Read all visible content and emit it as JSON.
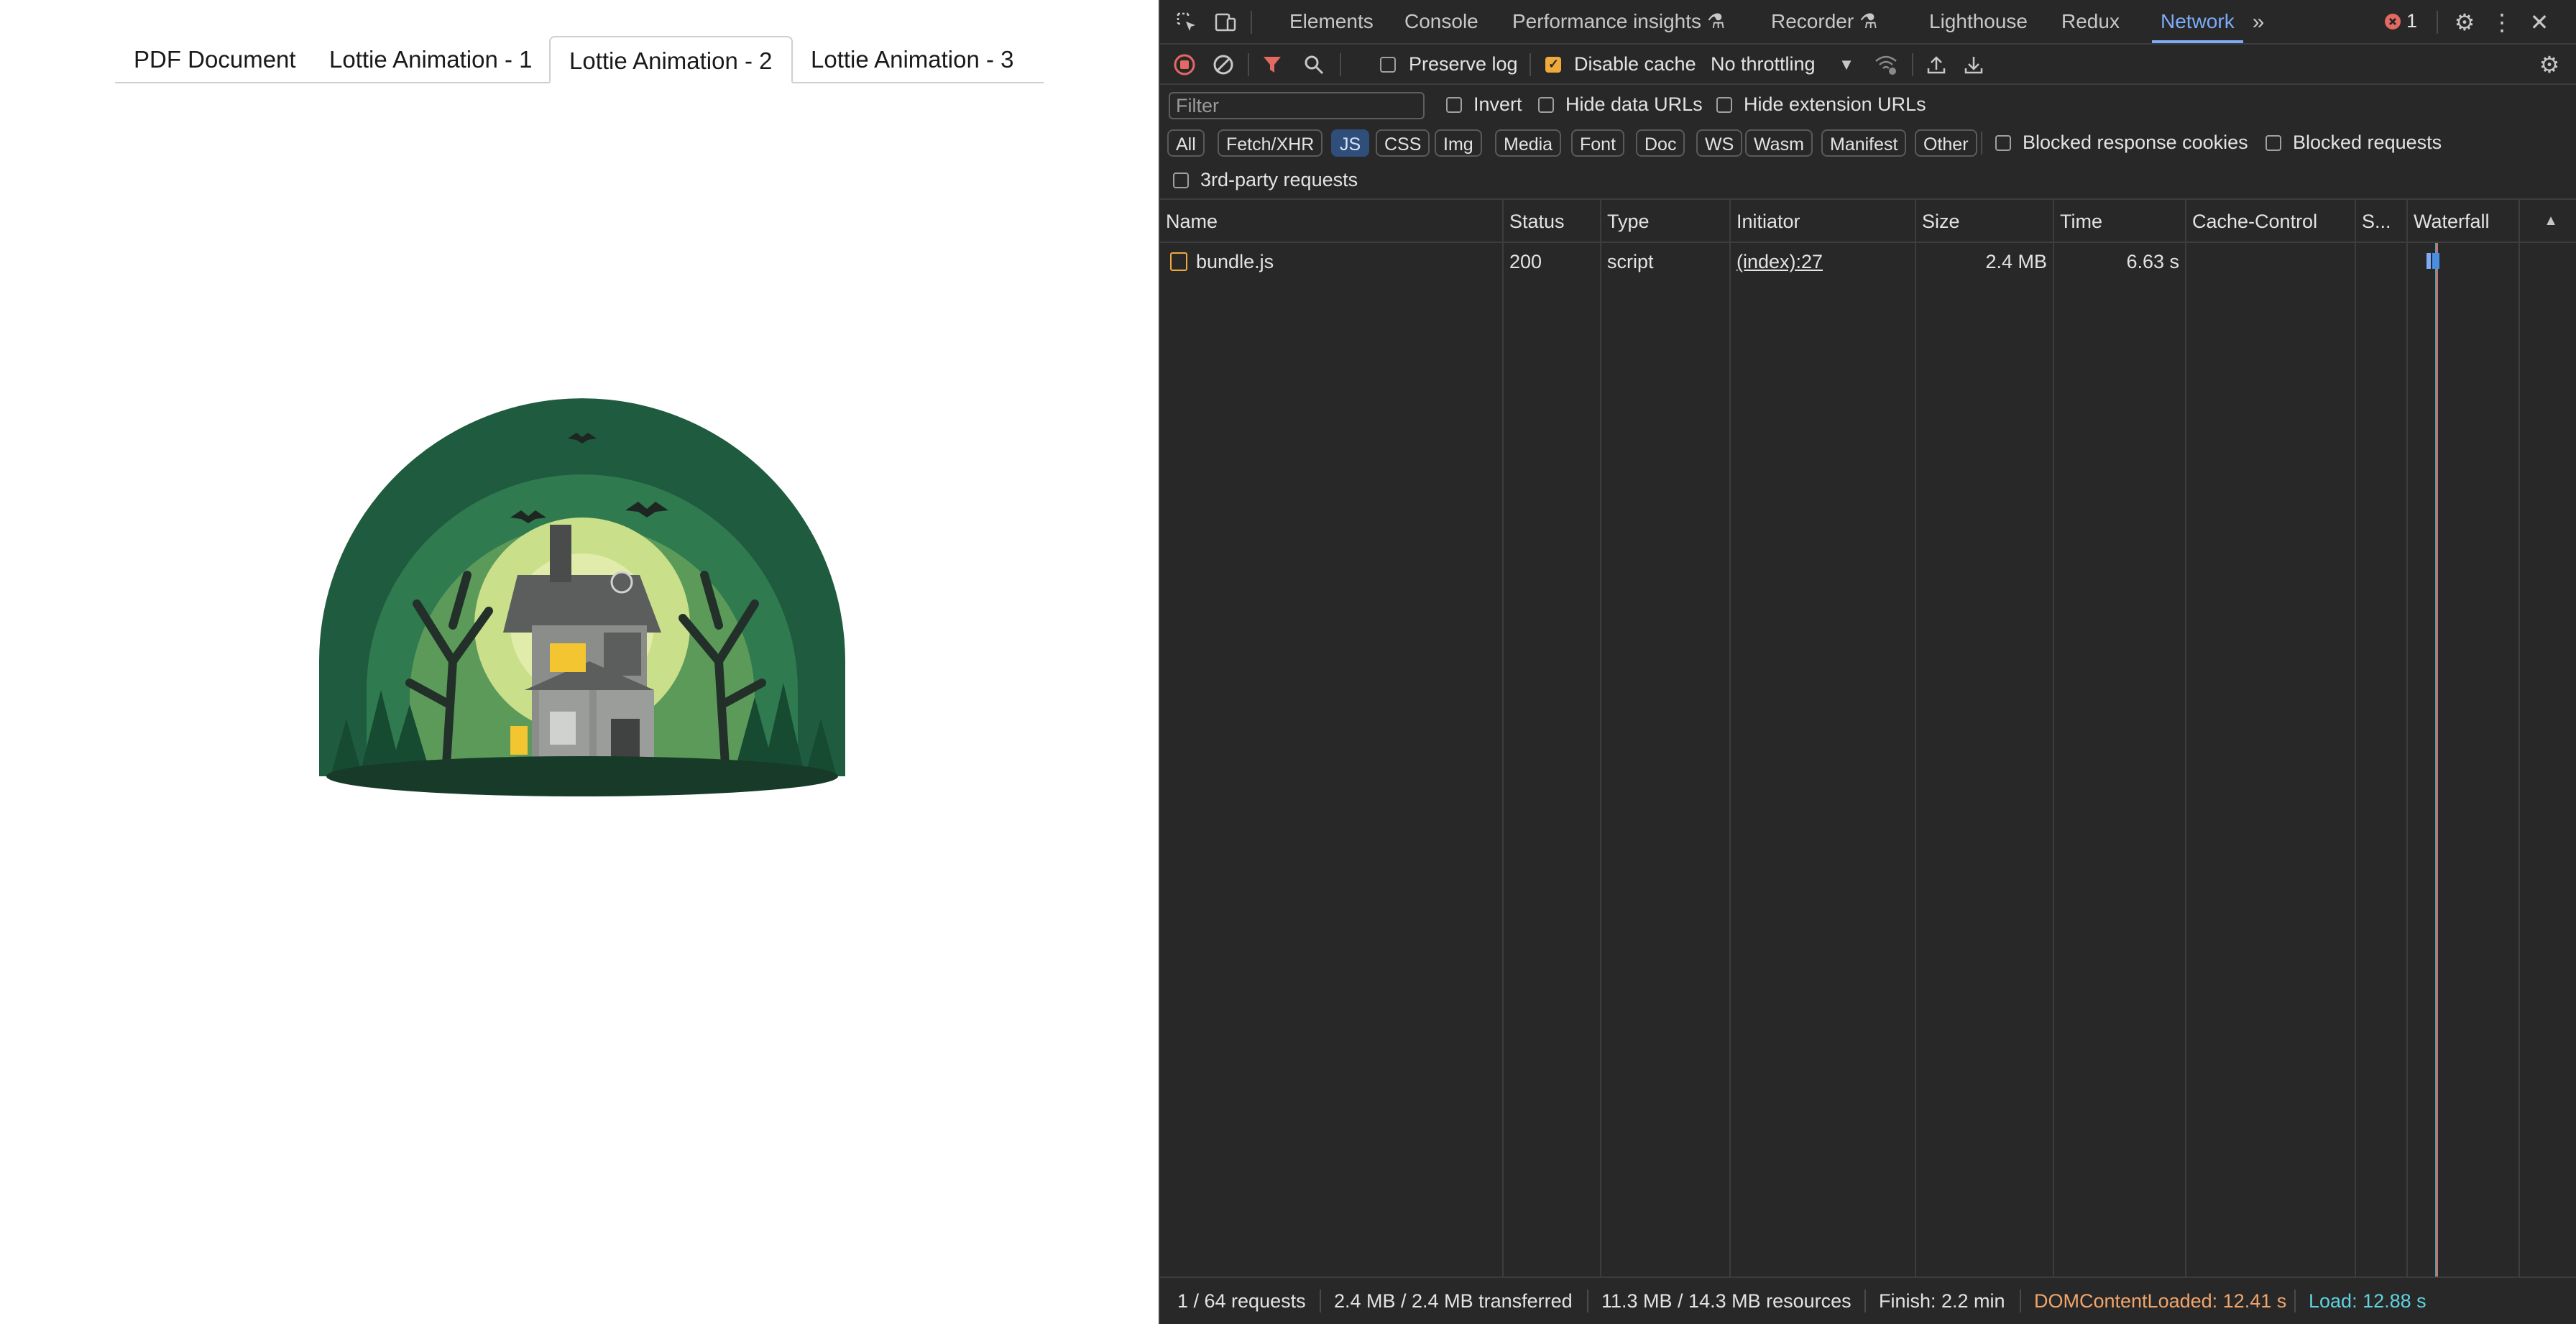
{
  "page": {
    "tabs": [
      {
        "label": "PDF Document",
        "active": false
      },
      {
        "label": "Lottie Animation - 1",
        "active": false
      },
      {
        "label": "Lottie Animation - 2",
        "active": true
      },
      {
        "label": "Lottie Animation - 3",
        "active": false
      }
    ],
    "illustration": "haunted-house-animation"
  },
  "devtools": {
    "tabs": [
      "Elements",
      "Console",
      "Performance insights",
      "Recorder",
      "Lighthouse",
      "Redux",
      "Network"
    ],
    "active_tab": "Network",
    "more_icon": "chevron-double-right-icon",
    "error_count": "1",
    "toolbar": {
      "preserve_log": {
        "label": "Preserve log",
        "checked": false
      },
      "disable_cache": {
        "label": "Disable cache",
        "checked": true
      },
      "throttling": "No throttling"
    },
    "filter": {
      "placeholder": "Filter",
      "invert": "Invert",
      "hide_data_urls": "Hide data URLs",
      "hide_extension_urls": "Hide extension URLs"
    },
    "type_filters": [
      "All",
      "Fetch/XHR",
      "JS",
      "CSS",
      "Img",
      "Media",
      "Font",
      "Doc",
      "WS",
      "Wasm",
      "Manifest",
      "Other"
    ],
    "selected_type": "JS",
    "blocked_response_cookies": "Blocked response cookies",
    "blocked_requests": "Blocked requests",
    "third_party": "3rd-party requests",
    "columns": [
      "Name",
      "Status",
      "Type",
      "Initiator",
      "Size",
      "Time",
      "Cache-Control",
      "S...",
      "Waterfall"
    ],
    "rows": [
      {
        "name": "bundle.js",
        "status": "200",
        "type": "script",
        "initiator": "(index):27",
        "size": "2.4 MB",
        "time": "6.63 s",
        "cache_control": "",
        "s": ""
      }
    ],
    "status_bar": {
      "requests": "1 / 64 requests",
      "transferred": "2.4 MB / 2.4 MB transferred",
      "resources": "11.3 MB / 14.3 MB resources",
      "finish": "Finish: 2.2 min",
      "dom_content_loaded": "DOMContentLoaded: 12.41 s",
      "load": "Load: 12.88 s"
    },
    "colors": {
      "accent": "#7cacf8",
      "dom_content_loaded": "#f0a56b",
      "load": "#5fd3e0",
      "error": "#e46962"
    }
  }
}
